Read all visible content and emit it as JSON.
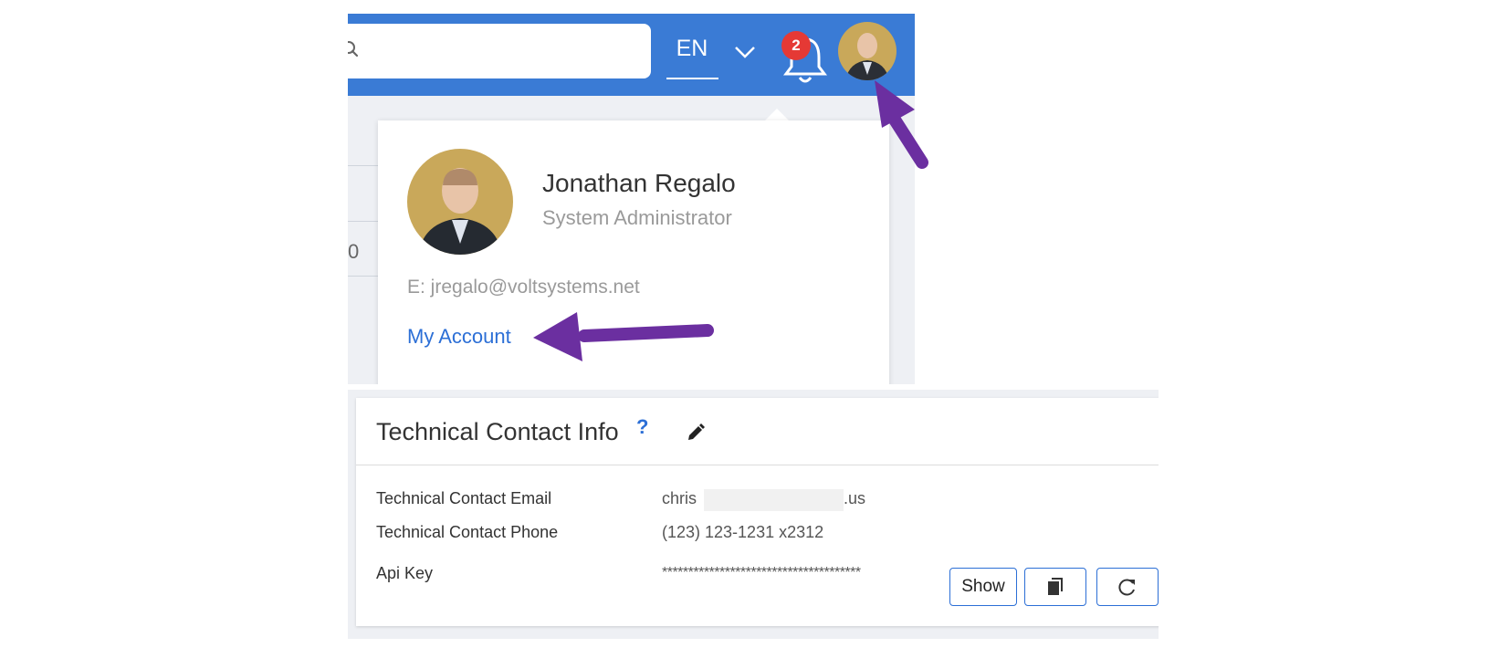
{
  "header": {
    "language": "EN",
    "notifications_count": "2",
    "search_icon": "search-icon",
    "chevron_icon": "chevron-down-icon",
    "bell_icon": "bell-icon",
    "header_color": "#3a7bd5",
    "badge_color": "#e53935"
  },
  "profile": {
    "name": "Jonathan Regalo",
    "role": "System Administrator",
    "email": "E: jregalo@voltsystems.net",
    "account_link": "My Account"
  },
  "page_stub_text": "0",
  "technical_contact": {
    "title": "Technical Contact Info",
    "help": "?",
    "edit_icon": "pencil-icon",
    "fields": [
      {
        "label": "Technical Contact Email",
        "value_prefix": "chris",
        "value_suffix": ".us"
      },
      {
        "label": "Technical Contact Phone",
        "value": "(123) 123-1231 x2312"
      },
      {
        "label": "Api Key",
        "value": "**************************************"
      }
    ],
    "buttons": {
      "show": "Show",
      "copy_icon": "copy-icon",
      "refresh_icon": "refresh-icon"
    }
  },
  "annotation_color": "#6b2fa0"
}
